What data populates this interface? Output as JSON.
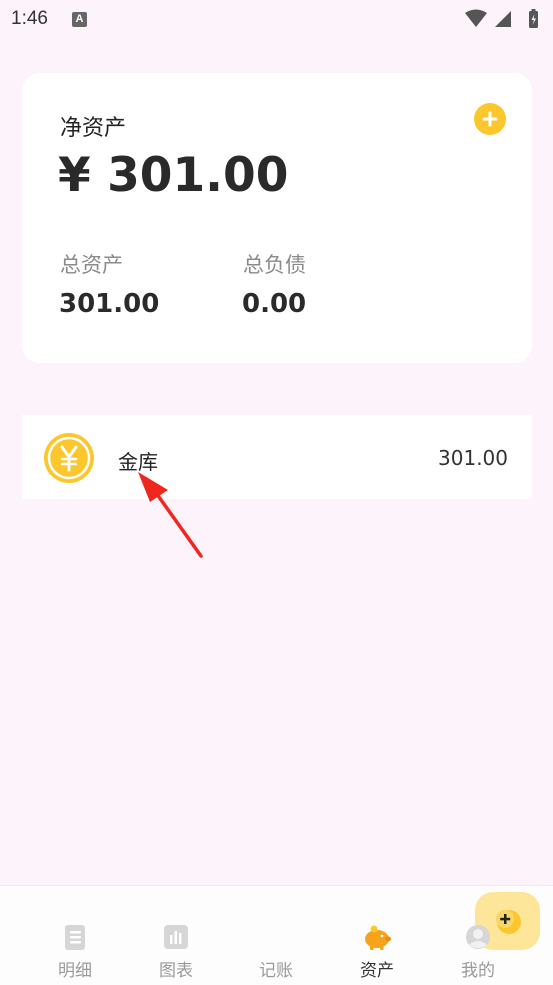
{
  "status_bar": {
    "time": "1:46",
    "notification_badge": "A"
  },
  "summary": {
    "title": "净资产",
    "net_amount": "¥ 301.00",
    "total_assets_label": "总资产",
    "total_assets_value": "301.00",
    "total_liabilities_label": "总负债",
    "total_liabilities_value": "0.00",
    "add_icon": "plus-circle-icon"
  },
  "accounts": [
    {
      "name": "金库",
      "balance": "301.00",
      "icon": "yen-coin-icon"
    }
  ],
  "bottom_nav": {
    "items": [
      {
        "label": "明细",
        "icon": "list-document-icon",
        "active": false
      },
      {
        "label": "图表",
        "icon": "bar-chart-icon",
        "active": false
      },
      {
        "label": "记账",
        "icon": "plus-bubble-icon",
        "active": false
      },
      {
        "label": "资产",
        "icon": "piggy-bank-icon",
        "active": true
      },
      {
        "label": "我的",
        "icon": "user-avatar-icon",
        "active": false
      }
    ]
  },
  "colors": {
    "background": "#fcf3fb",
    "accent_yellow": "#fcc72c",
    "active_nav": "#f5a31a",
    "arrow": "#f0271e"
  }
}
